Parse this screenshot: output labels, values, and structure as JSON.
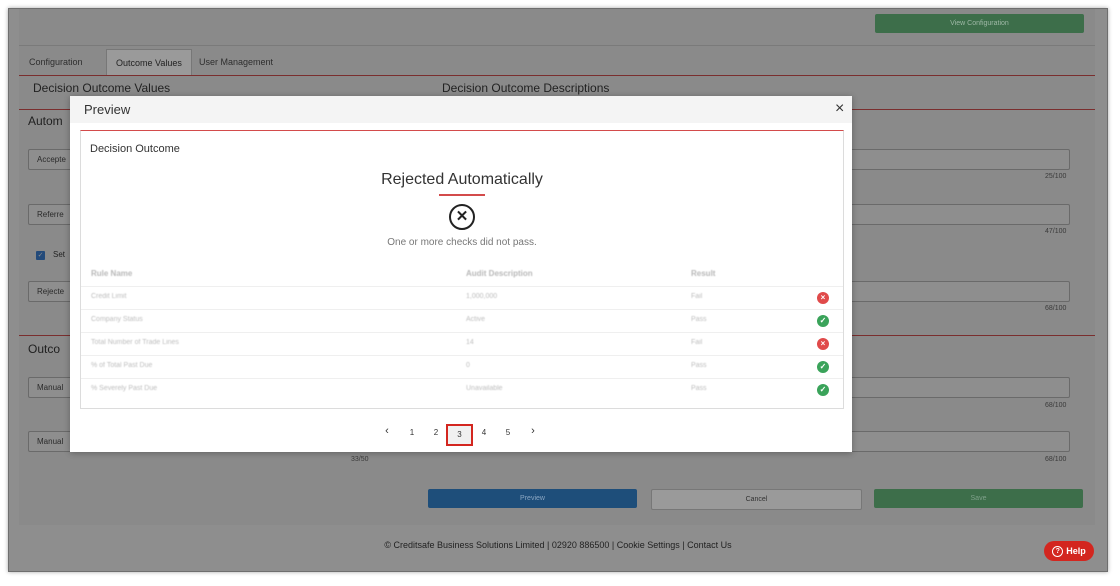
{
  "background": {
    "view_config_label": "View Configuration",
    "tabs": [
      "Configuration",
      "Outcome Values",
      "User Management"
    ],
    "heading_left": "Decision Outcome Values",
    "heading_right": "Decision Outcome Descriptions",
    "section1_title": "Autom",
    "selects": [
      "Accepte",
      "Referre",
      "Rejecte"
    ],
    "checkbox_label": "Set",
    "counters": [
      "25/100",
      "47/100",
      "68/100"
    ],
    "section2_title": "Outco",
    "selects2": [
      "Manual",
      "Manual"
    ],
    "counters2": [
      "68/100",
      "68/100"
    ],
    "counter_left": "33/50",
    "buttons": {
      "preview": "Preview",
      "cancel": "Cancel",
      "save": "Save"
    },
    "footer": "© Creditsafe Business Solutions Limited | 02920 886500 | Cookie Settings | Contact Us",
    "help": "Help"
  },
  "modal": {
    "title": "Preview",
    "close": "×",
    "card_title": "Decision Outcome",
    "result_title": "Rejected Automatically",
    "result_icon": "x-circle-icon",
    "result_subtitle": "One or more checks did not pass.",
    "table": {
      "headers": [
        "Rule Name",
        "Audit Description",
        "Result"
      ],
      "rows": [
        {
          "rule": "Credit Limit",
          "audit": "1,000,000",
          "result": "Fail",
          "status": "fail"
        },
        {
          "rule": "Company Status",
          "audit": "Active",
          "result": "Pass",
          "status": "pass"
        },
        {
          "rule": "Total Number of Trade Lines",
          "audit": "14",
          "result": "Fail",
          "status": "fail"
        },
        {
          "rule": "% of Total Past Due",
          "audit": "0",
          "result": "Pass",
          "status": "pass"
        },
        {
          "rule": "% Severely Past Due",
          "audit": "Unavailable",
          "result": "Pass",
          "status": "pass"
        }
      ]
    },
    "pagination": {
      "prev": "‹",
      "pages": [
        "1",
        "2",
        "3",
        "4",
        "5"
      ],
      "current": "3",
      "next": "›"
    }
  },
  "colors": {
    "accent_red": "#d34b4b",
    "pass_green": "#3aa35a",
    "fail_red": "#e04a4a",
    "help_red": "#d3261f"
  }
}
